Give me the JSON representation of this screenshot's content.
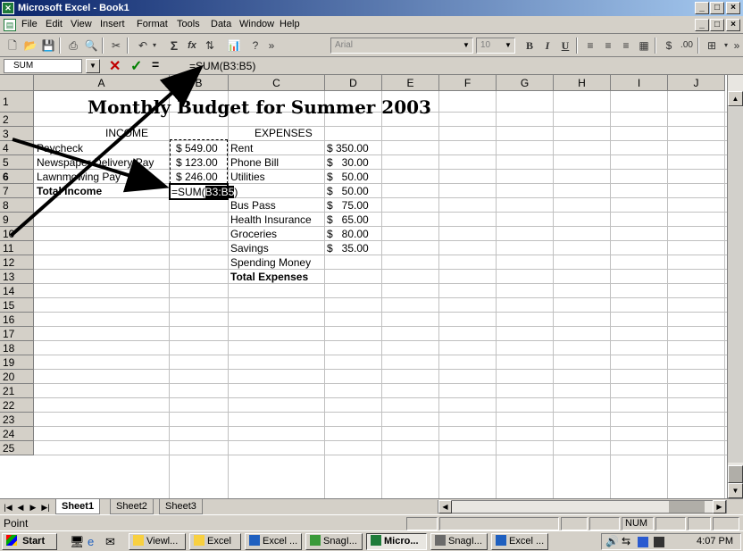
{
  "window": {
    "title": "Microsoft Excel - Book1"
  },
  "menu": [
    "File",
    "Edit",
    "View",
    "Insert",
    "Format",
    "Tools",
    "Data",
    "Window",
    "Help"
  ],
  "toolbar": {
    "font": "Arial",
    "size": "10",
    "bold": "B",
    "italic": "I",
    "underline": "U",
    "currency": "$",
    "decimal": ".00",
    "autosum": "Σ",
    "function": "fx"
  },
  "formula_bar": {
    "name_box": "SUM",
    "cancel": "✕",
    "enter": "✓",
    "equals": "=",
    "formula": "=SUM(B3:B5)"
  },
  "columns": [
    "A",
    "B",
    "C",
    "D",
    "E",
    "F",
    "G",
    "H",
    "I",
    "J"
  ],
  "rows": [
    "1",
    "2",
    "3",
    "4",
    "5",
    "6",
    "7",
    "8",
    "9",
    "10",
    "11",
    "12",
    "13",
    "14",
    "15",
    "16",
    "17",
    "18",
    "19",
    "20",
    "21",
    "22",
    "23",
    "24",
    "25"
  ],
  "sheet": {
    "title": "Monthly Budget for Summer 2003",
    "income_header": "INCOME",
    "expenses_header": "EXPENSES",
    "income": [
      {
        "label": "Paycheck",
        "value": "$ 549.00"
      },
      {
        "label": "Newspaper Delivery Pay",
        "value": "$ 123.00"
      },
      {
        "label": "Lawnmowing Pay",
        "value": "$ 246.00"
      }
    ],
    "total_income_label": "Total Income",
    "total_income_formula": "=SUM(B3:B5)",
    "expenses": [
      {
        "label": "Rent",
        "value": "$ 350.00"
      },
      {
        "label": "Phone Bill",
        "value": "$   30.00"
      },
      {
        "label": "Utilities",
        "value": "$   50.00"
      },
      {
        "label": "",
        "value": "$   50.00"
      },
      {
        "label": "Bus Pass",
        "value": "$   75.00"
      },
      {
        "label": "Health Insurance",
        "value": "$   65.00"
      },
      {
        "label": "Groceries",
        "value": "$   80.00"
      },
      {
        "label": "Savings",
        "value": "$   35.00"
      },
      {
        "label": "Spending Money",
        "value": ""
      }
    ],
    "total_expenses_label": "Total Expenses"
  },
  "tabs": [
    "Sheet1",
    "Sheet2",
    "Sheet3"
  ],
  "status": {
    "mode": "Point",
    "num": "NUM"
  },
  "taskbar": {
    "start": "Start",
    "tasks": [
      "Viewl...",
      "Excel",
      "Excel ...",
      "SnagI...",
      "Micro...",
      "SnagI...",
      "Excel ..."
    ],
    "clock": "4:07 PM"
  }
}
